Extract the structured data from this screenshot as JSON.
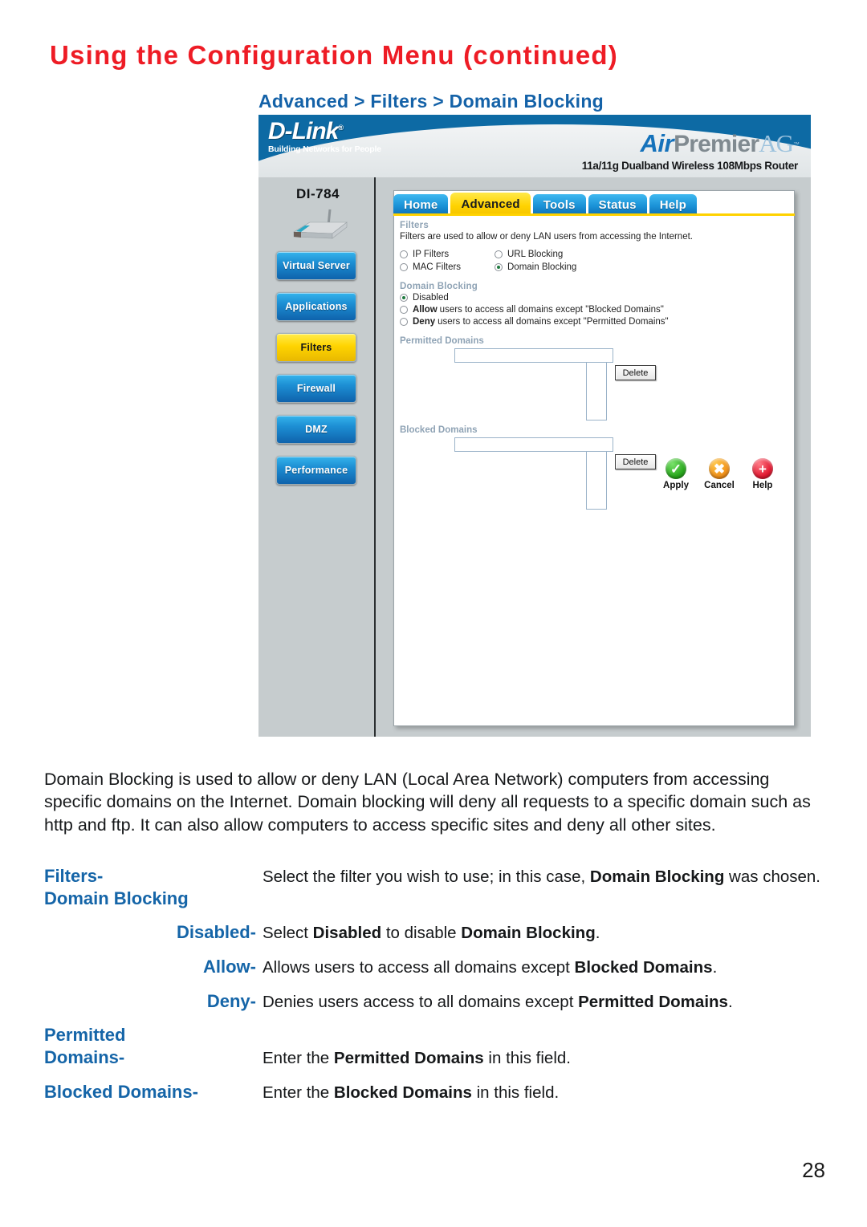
{
  "page": {
    "title": "Using the Configuration Menu (continued)",
    "breadcrumb": "Advanced > Filters > Domain Blocking",
    "number": "28",
    "title_color": "#ee1c25",
    "accent_color": "#1565a8"
  },
  "router_ui": {
    "brand": {
      "name": "D-Link",
      "registered": "®",
      "tagline": "Building Networks for People",
      "product_air": "Air",
      "product_premier": "Premier",
      "product_ag": "AG",
      "product_tm": "™",
      "product_subtitle": "11a/11g Dualband Wireless 108Mbps Router"
    },
    "model": "DI-784",
    "tabs": [
      {
        "label": "Home",
        "active": false
      },
      {
        "label": "Advanced",
        "active": true
      },
      {
        "label": "Tools",
        "active": false
      },
      {
        "label": "Status",
        "active": false
      },
      {
        "label": "Help",
        "active": false
      }
    ],
    "sidebar_buttons": [
      {
        "label": "Virtual Server",
        "active": false
      },
      {
        "label": "Applications",
        "active": false
      },
      {
        "label": "Filters",
        "active": true
      },
      {
        "label": "Firewall",
        "active": false
      },
      {
        "label": "DMZ",
        "active": false
      },
      {
        "label": "Performance",
        "active": false
      }
    ],
    "filters": {
      "heading": "Filters",
      "description": "Filters are used to allow or deny LAN users from accessing the Internet.",
      "options": [
        {
          "label": "IP Filters",
          "selected": false
        },
        {
          "label": "URL Blocking",
          "selected": false
        },
        {
          "label": "MAC Filters",
          "selected": false
        },
        {
          "label": "Domain Blocking",
          "selected": true
        }
      ]
    },
    "domain_blocking": {
      "heading": "Domain Blocking",
      "option_disabled": "Disabled",
      "option_allow_bold": "Allow",
      "option_allow_rest": "users to access all domains except \"Blocked Domains\"",
      "option_deny_bold": "Deny",
      "option_deny_rest": "users to access all domains except \"Permitted Domains\"",
      "selected": "Disabled"
    },
    "permitted": {
      "label": "Permitted Domains",
      "input_value": "",
      "delete_label": "Delete"
    },
    "blocked": {
      "label": "Blocked Domains",
      "input_value": "",
      "delete_label": "Delete"
    },
    "actions": [
      {
        "label": "Apply",
        "icon": "check-circle-icon",
        "color": "#2aa81e"
      },
      {
        "label": "Cancel",
        "icon": "cross-circle-icon",
        "color": "#f0921b"
      },
      {
        "label": "Help",
        "icon": "plus-circle-icon",
        "color": "#e21b33"
      }
    ]
  },
  "body": {
    "intro": "Domain Blocking is used to allow or deny LAN (Local Area Network) computers from accessing specific domains on the Internet. Domain blocking will deny all requests to a specific domain such as http and ftp. It can also allow computers to access specific sites and deny all other sites."
  },
  "definitions": [
    {
      "term": "Filters-",
      "term2": "Domain Blocking",
      "align": "left",
      "desc_parts": [
        {
          "text": "Select the filter you wish to use; in this case, ",
          "bold": false
        },
        {
          "text": "Domain Blocking",
          "bold": true
        },
        {
          "text": " was chosen.",
          "bold": false
        }
      ]
    },
    {
      "term": "Disabled-",
      "align": "right",
      "desc_parts": [
        {
          "text": "Select ",
          "bold": false
        },
        {
          "text": "Disabled",
          "bold": true
        },
        {
          "text": " to disable ",
          "bold": false
        },
        {
          "text": "Domain Blocking",
          "bold": true
        },
        {
          "text": ".",
          "bold": false
        }
      ]
    },
    {
      "term": "Allow-",
      "align": "right",
      "desc_parts": [
        {
          "text": "Allows users to access all domains except ",
          "bold": false
        },
        {
          "text": "Blocked Domains",
          "bold": true
        },
        {
          "text": ".",
          "bold": false
        }
      ]
    },
    {
      "term": "Deny-",
      "align": "right",
      "desc_parts": [
        {
          "text": "Denies users  access to  all domains except ",
          "bold": false
        },
        {
          "text": "Permitted Domains",
          "bold": true
        },
        {
          "text": ".",
          "bold": false
        }
      ]
    },
    {
      "term": "Permitted",
      "term2": "Domains-",
      "align": "left",
      "desc_parts": [
        {
          "text": "Enter the ",
          "bold": false
        },
        {
          "text": "Permitted Domains",
          "bold": true
        },
        {
          "text": " in this field.",
          "bold": false
        }
      ]
    },
    {
      "term": "Blocked Domains-",
      "align": "left",
      "desc_parts": [
        {
          "text": "Enter the ",
          "bold": false
        },
        {
          "text": "Blocked Domains",
          "bold": true
        },
        {
          "text": " in this field.",
          "bold": false
        }
      ]
    }
  ]
}
